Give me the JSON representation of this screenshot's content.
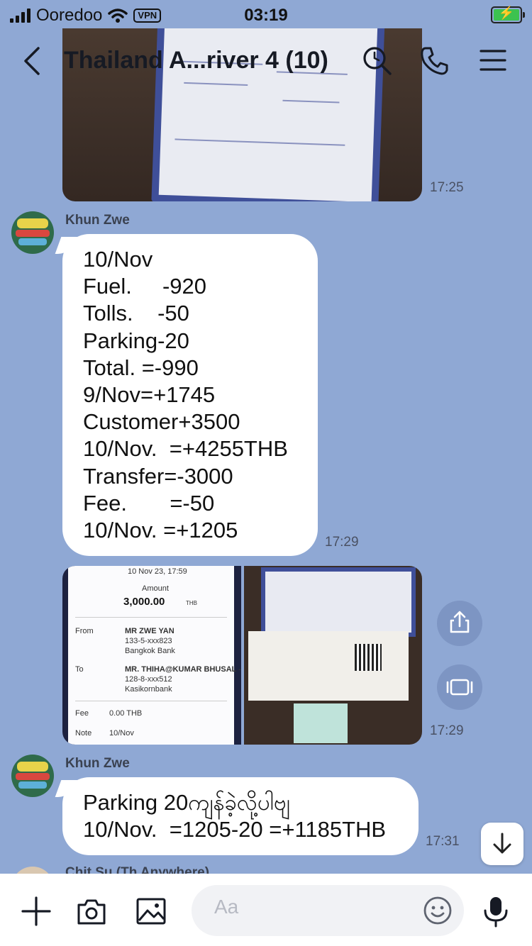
{
  "status_bar": {
    "carrier": "Ooredoo",
    "vpn": "VPN",
    "time": "03:19"
  },
  "nav": {
    "title": "Thailand A...river 4 (10)",
    "icons": [
      "back-arrow-icon",
      "search-icon",
      "phone-icon",
      "menu-icon"
    ]
  },
  "messages": {
    "photo_time": "17:25",
    "msg1": {
      "sender": "Khun Zwe",
      "lines": [
        "10/Nov",
        "Fuel.     -920",
        "Tolls.    -50",
        "Parking-20",
        "Total. =-990",
        "9/Nov=+1745",
        "Customer+3500",
        "10/Nov.  =+4255THB",
        "Transfer=-3000",
        "Fee.       =-50",
        "10/Nov. =+1205"
      ],
      "time": "17:29"
    },
    "images": {
      "receipt_date": "10 Nov 23, 17:59",
      "amount_label": "Amount",
      "amount": "3,000.00",
      "currency": "THB",
      "from_label": "From",
      "from_name": "MR ZWE YAN",
      "from_acct": "133-5-xxx823",
      "from_bank": "Bangkok Bank",
      "to_label": "To",
      "to_name": "MR. THIHA@KUMAR BHUSAL -",
      "to_acct": "128-8-xxx512",
      "to_bank": "Kasikornbank",
      "fee_label": "Fee",
      "fee": "0.00 THB",
      "note_label": "Note",
      "note": "10/Nov",
      "time": "17:29"
    },
    "msg2": {
      "sender": "Khun Zwe",
      "lines": [
        "Parking 20ကျန်ခဲ့လို့ပါဗျ",
        "10/Nov.  =1205-20 =+1185THB"
      ],
      "time": "17:31"
    },
    "next_sender": "Chit Su (Th Anywhere)"
  },
  "composer": {
    "placeholder": "Aa"
  },
  "colors": {
    "background": "#8fa8d4",
    "bubble": "#ffffff",
    "battery": "#3cc24f"
  }
}
